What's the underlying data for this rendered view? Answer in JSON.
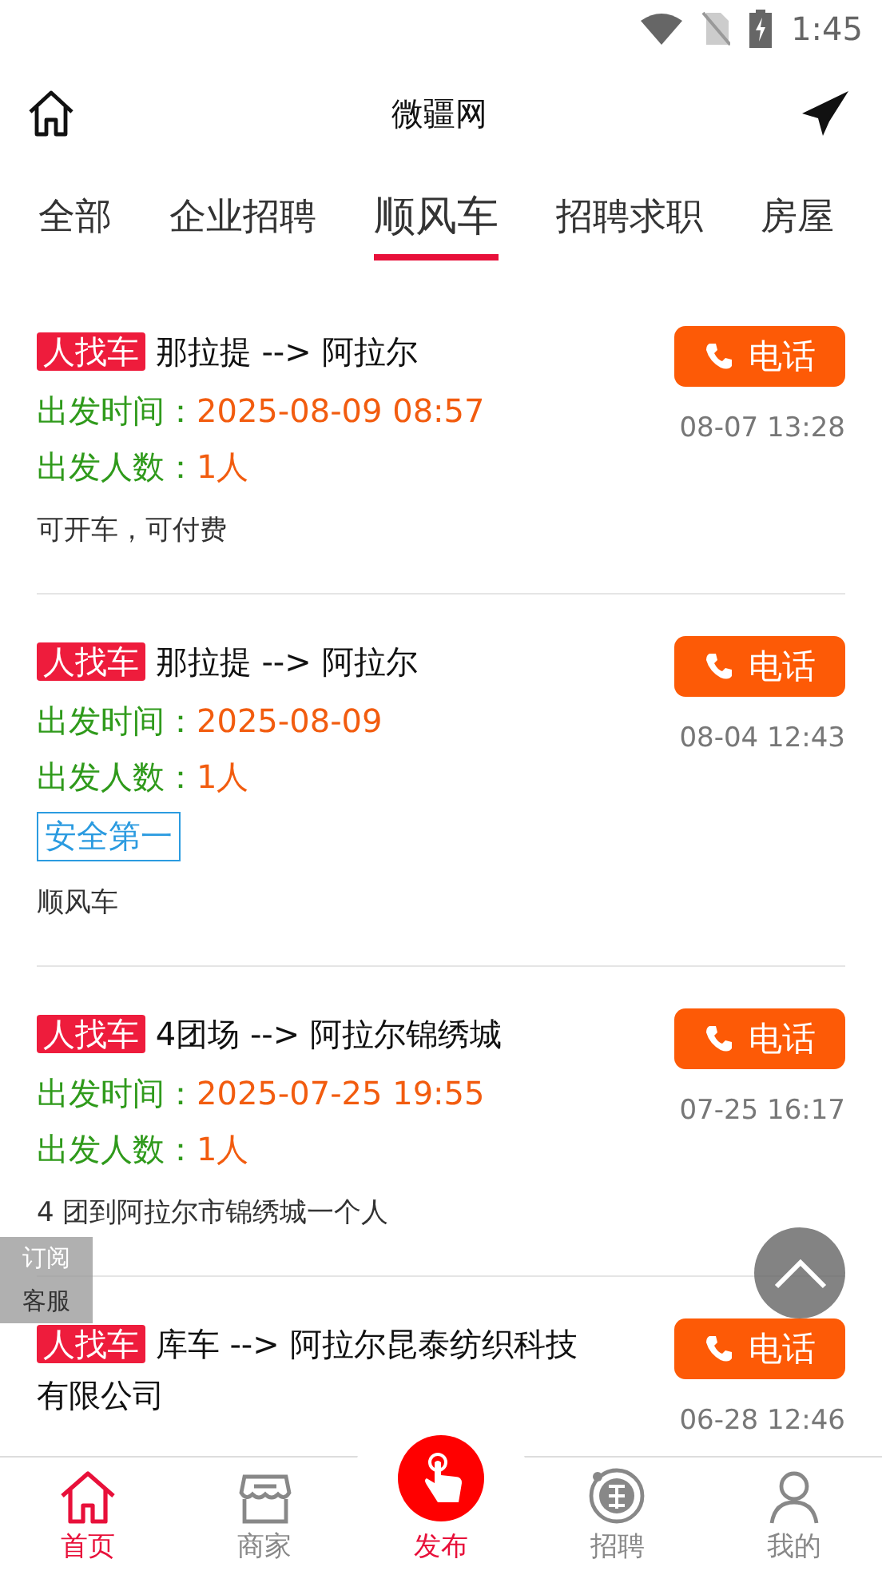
{
  "status_bar": {
    "time": "1:45"
  },
  "header": {
    "title": "微疆网"
  },
  "tabs": [
    {
      "label": "全部",
      "selected": false
    },
    {
      "label": "企业招聘",
      "selected": false
    },
    {
      "label": "顺风车",
      "selected": true
    },
    {
      "label": "招聘求职",
      "selected": false
    },
    {
      "label": "房屋",
      "selected": false
    }
  ],
  "posts": [
    {
      "tag": "人找车",
      "route": "那拉提 --> 阿拉尔",
      "time_label": "出发时间：",
      "time": "2025-08-09 08:57",
      "people_label": "出发人数：",
      "people": "1人",
      "note": "可开车，可付费",
      "call": "电话",
      "date": "08-07 13:28"
    },
    {
      "tag": "人找车",
      "route": "那拉提 --> 阿拉尔",
      "time_label": "出发时间：",
      "time": "2025-08-09",
      "people_label": "出发人数：",
      "people": "1人",
      "badge": "安全第一",
      "note": "顺风车",
      "call": "电话",
      "date": "08-04 12:43"
    },
    {
      "tag": "人找车",
      "route": "4团场 --> 阿拉尔锦绣城",
      "time_label": "出发时间：",
      "time": "2025-07-25 19:55",
      "people_label": "出发人数：",
      "people": "1人",
      "note": "4 团到阿拉尔市锦绣城一个人",
      "call": "电话",
      "date": "07-25 16:17"
    },
    {
      "tag": "人找车",
      "route": "库车 --> 阿拉尔昆泰纺织科技有限公司",
      "call": "电话",
      "date": "06-28 12:46"
    }
  ],
  "side_panel": [
    "订阅",
    "客服"
  ],
  "bottom_nav": [
    {
      "label": "首页",
      "selected": true
    },
    {
      "label": "商家",
      "selected": false
    },
    {
      "label": "招聘",
      "selected": false
    },
    {
      "label": "我的",
      "selected": false
    }
  ],
  "publish_button": {
    "label": "发布"
  }
}
